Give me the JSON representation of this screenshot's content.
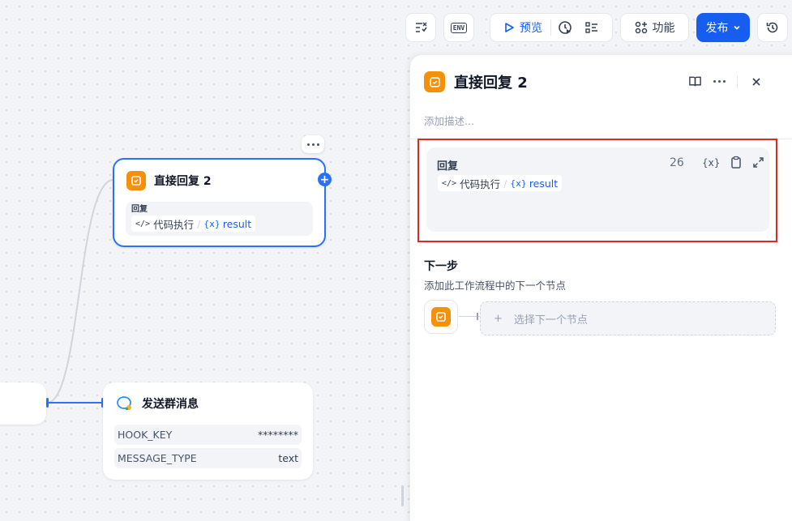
{
  "canvas": {
    "reply_node": {
      "title": "直接回复 2",
      "field_label": "回复",
      "var_source": "代码执行",
      "var_separator": "/",
      "var_name": "result",
      "add_symbol": "+"
    },
    "group_message_node": {
      "title": "发送群消息",
      "params": [
        {
          "key": "HOOK_KEY",
          "value": "********"
        },
        {
          "key": "MESSAGE_TYPE",
          "value": "text"
        }
      ]
    }
  },
  "toolbar": {
    "checklist_icon": "checklist-icon",
    "env_label": "ENV",
    "preview_label": "预览",
    "features_label": "功能",
    "publish_label": "发布",
    "accent": "#155eef"
  },
  "panel": {
    "title": "直接回复 2",
    "description_placeholder": "添加描述...",
    "reply": {
      "label": "回复",
      "count": "26",
      "var_source": "代码执行",
      "var_separator": "/",
      "var_name": "result"
    },
    "next_step": {
      "title": "下一步",
      "description": "添加此工作流程中的下一个节点",
      "select_label": "选择下一个节点",
      "plus": "+"
    }
  },
  "colors": {
    "node_icon": "#f79009",
    "selected_border": "#2970ff",
    "highlight_border": "#d92d20"
  }
}
